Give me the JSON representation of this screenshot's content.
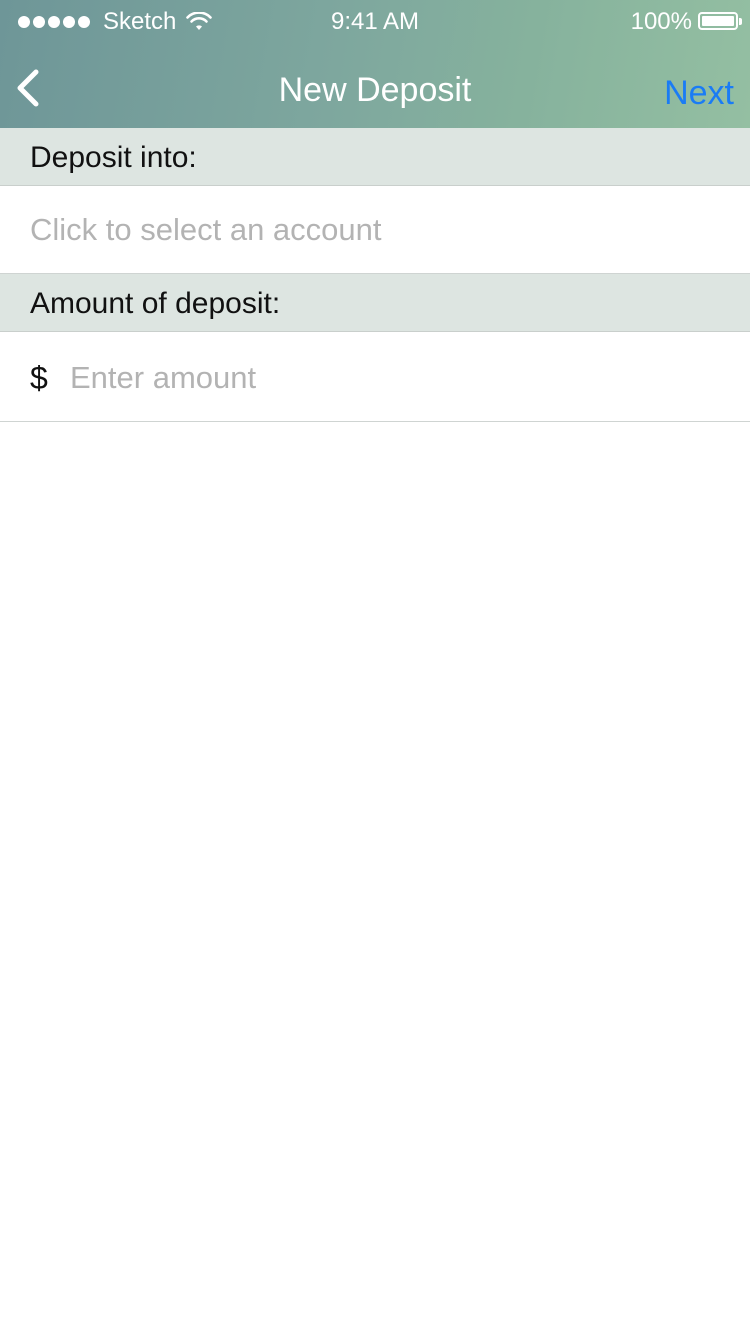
{
  "status_bar": {
    "carrier": "Sketch",
    "time": "9:41 AM",
    "battery": "100%",
    "signal_icon": "signal-dots-icon",
    "wifi_icon": "wifi-icon",
    "battery_icon": "battery-icon"
  },
  "nav": {
    "back_icon": "chevron-left-icon",
    "title": "New Deposit",
    "next_label": "Next"
  },
  "deposit_into": {
    "label": "Deposit into:",
    "placeholder": "Click to select an account"
  },
  "amount": {
    "label": "Amount of deposit:",
    "currency": "$",
    "placeholder": "Enter amount",
    "value": ""
  },
  "colors": {
    "header_gradient_start": "#6e9698",
    "header_gradient_end": "#94bfa2",
    "accent": "#1a7cf5",
    "section_bg": "#dde5e1",
    "placeholder": "#b3b3b3"
  }
}
